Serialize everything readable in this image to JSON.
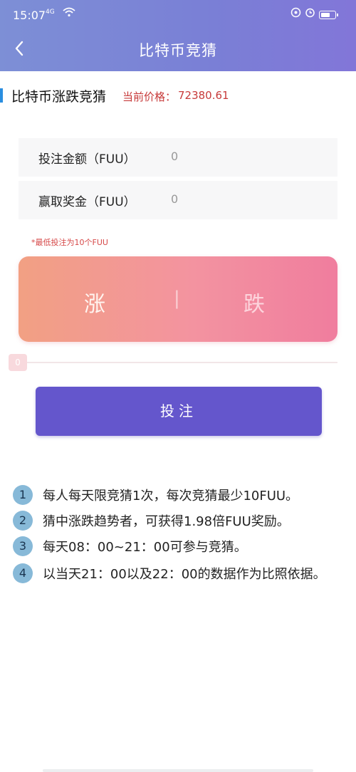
{
  "status_bar": {
    "time": "15:07",
    "network": "4G",
    "icons": [
      "signal-icon",
      "wifi-icon",
      "alarm-icon",
      "clock-icon",
      "battery-icon"
    ]
  },
  "header": {
    "back_icon": "‹",
    "title": "比特币竞猜"
  },
  "section": {
    "title": "比特币涨跌竞猜",
    "price_label": "当前价格：",
    "price_value": "72380.61"
  },
  "form": {
    "bet_label": "投注金额（FUU）",
    "bet_value": "0",
    "win_label": "赢取奖金（FUU）",
    "win_value": "0",
    "hint": "*最低投注为10个FUU"
  },
  "choice": {
    "up": "涨",
    "separator": "|",
    "down": "跌"
  },
  "slider": {
    "value": "0"
  },
  "submit_label": "投注",
  "rules": [
    {
      "num": "1",
      "text": "每人每天限竞猜1次，每次竞猜最少10FUU。"
    },
    {
      "num": "2",
      "text": "猜中涨跌趋势者，可获得1.98倍FUU奖励。"
    },
    {
      "num": "3",
      "text": "每天08：00~21：00可参与竞猜。"
    },
    {
      "num": "4",
      "text": "以当天21：00以及22：00的数据作为比照依据。"
    }
  ],
  "colors": {
    "header": "#7a7fd6",
    "accent_red": "#c73a3a",
    "submit": "#6456cc",
    "rule_badge": "#87b9d8"
  }
}
